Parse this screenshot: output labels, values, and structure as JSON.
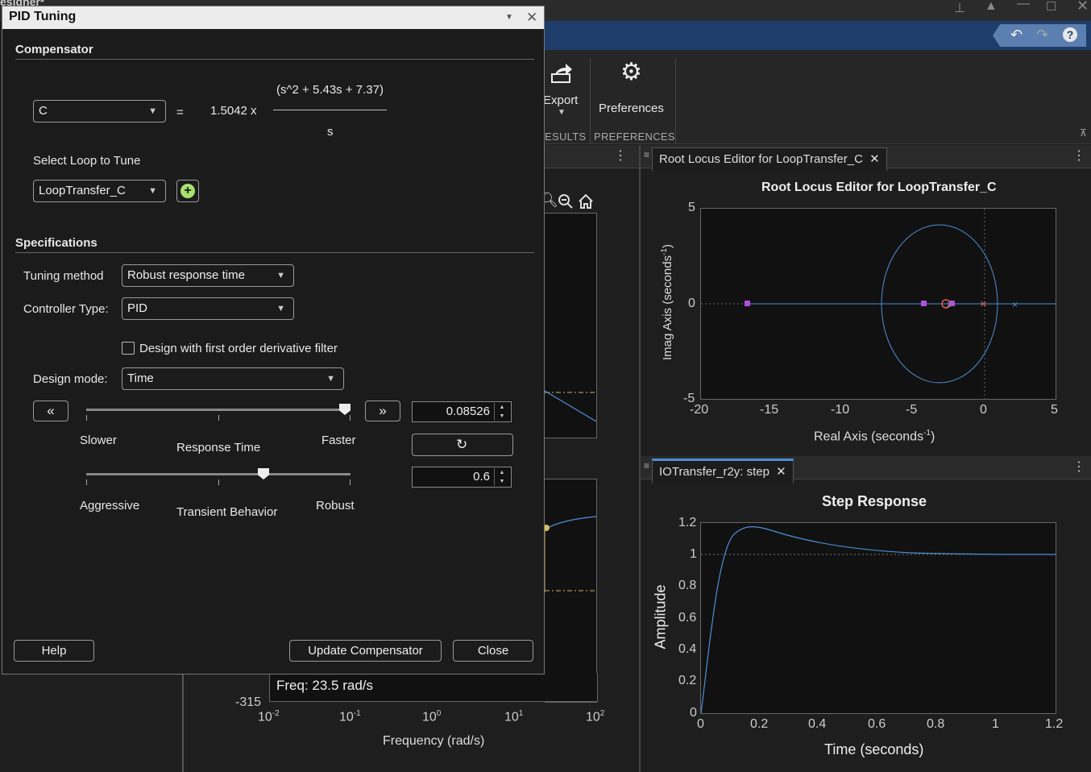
{
  "app": {
    "window_title_fragment": "esigner*"
  },
  "ribbon": {
    "export_label": "Export",
    "preferences_label": "Preferences",
    "results_section": "ESULTS",
    "preferences_section": "PREFERENCES"
  },
  "root_locus": {
    "tab_label": "Root Locus Editor for LoopTransfer_C",
    "title": "Root Locus Editor for LoopTransfer_C",
    "xlabel": "Real  Axis  (seconds",
    "xlabel_sup": "-1",
    "ylabel": "Imag  Axis  (seconds",
    "ylabel_sup": "-1",
    "xticks": [
      "-20",
      "-15",
      "-10",
      "-5",
      "0",
      "5"
    ],
    "yticks": [
      "5",
      "0",
      "-5"
    ]
  },
  "step": {
    "tab_label": "IOTransfer_r2y: step",
    "title": "Step Response",
    "xlabel": "Time (seconds)",
    "ylabel": "Amplitude",
    "xticks": [
      "0",
      "0.2",
      "0.4",
      "0.6",
      "0.8",
      "1",
      "1.2"
    ],
    "yticks": [
      "1.2",
      "1",
      "0.8",
      "0.6",
      "0.4",
      "0.2",
      "0"
    ]
  },
  "bode": {
    "freq_readout": "Freq: 23.5 rad/s",
    "y_tick_bottom": "-315",
    "xlabel": "Frequency (rad/s)",
    "xticks": [
      {
        "base": "10",
        "exp": "-2"
      },
      {
        "base": "10",
        "exp": "-1"
      },
      {
        "base": "10",
        "exp": "0"
      },
      {
        "base": "10",
        "exp": "1"
      },
      {
        "base": "10",
        "exp": "2"
      }
    ]
  },
  "dialog": {
    "title": "PID Tuning",
    "compensator_section": "Compensator",
    "compensator_select": "C",
    "equals": "=",
    "gain": "1.5042 x",
    "numerator": "(s^2 + 5.43s + 7.37)",
    "denominator": "s",
    "select_loop_label": "Select Loop to Tune",
    "loop_select": "LoopTransfer_C",
    "specifications_section": "Specifications",
    "tuning_method_label": "Tuning method",
    "tuning_method_value": "Robust response time",
    "controller_type_label": "Controller Type:",
    "controller_type_value": "PID",
    "derivative_filter_label": "Design with first order derivative filter",
    "design_mode_label": "Design mode:",
    "design_mode_value": "Time",
    "response_time_value": "0.08526",
    "response_time_slider_fraction": 0.98,
    "slower_label": "Slower",
    "response_time_label": "Response Time",
    "faster_label": "Faster",
    "transient_value": "0.6",
    "transient_slider_fraction": 0.67,
    "aggressive_label": "Aggressive",
    "transient_behavior_label": "Transient Behavior",
    "robust_label": "Robust",
    "help_button": "Help",
    "update_button": "Update Compensator",
    "close_button": "Close"
  }
}
